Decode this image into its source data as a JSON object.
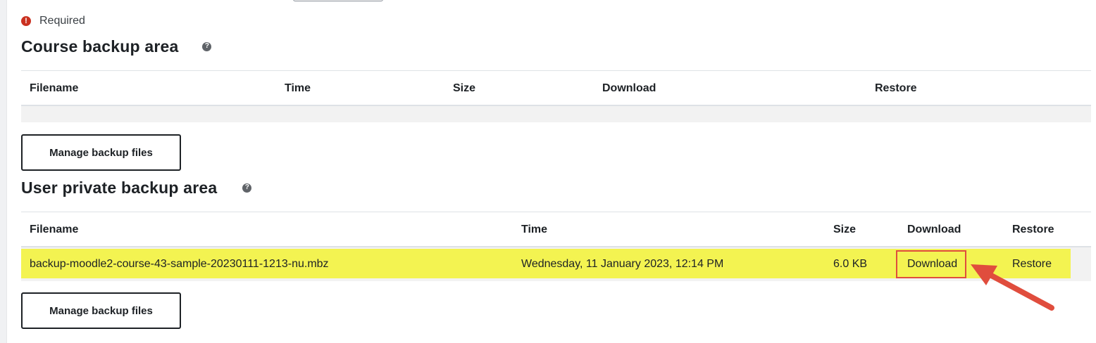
{
  "required_label": "Required",
  "required_icon": "exclamation-circle-icon",
  "course_area": {
    "title": "Course backup area",
    "help_icon": "question-circle-icon",
    "headers": [
      "Filename",
      "Time",
      "Size",
      "Download",
      "Restore"
    ],
    "rows": [],
    "manage_button": "Manage backup files"
  },
  "user_area": {
    "title": "User private backup area",
    "help_icon": "question-circle-icon",
    "headers": [
      "Filename",
      "Time",
      "Size",
      "Download",
      "Restore"
    ],
    "rows": [
      {
        "filename": "backup-moodle2-course-43-sample-20230111-1213-nu.mbz",
        "time": "Wednesday, 11 January 2023, 12:14 PM",
        "size": "6.0 KB",
        "download": "Download",
        "restore": "Restore"
      }
    ],
    "manage_button": "Manage backup files"
  },
  "colors": {
    "row_highlight": "#f3f351",
    "callout": "#e04d3d",
    "required": "#ca3120"
  }
}
